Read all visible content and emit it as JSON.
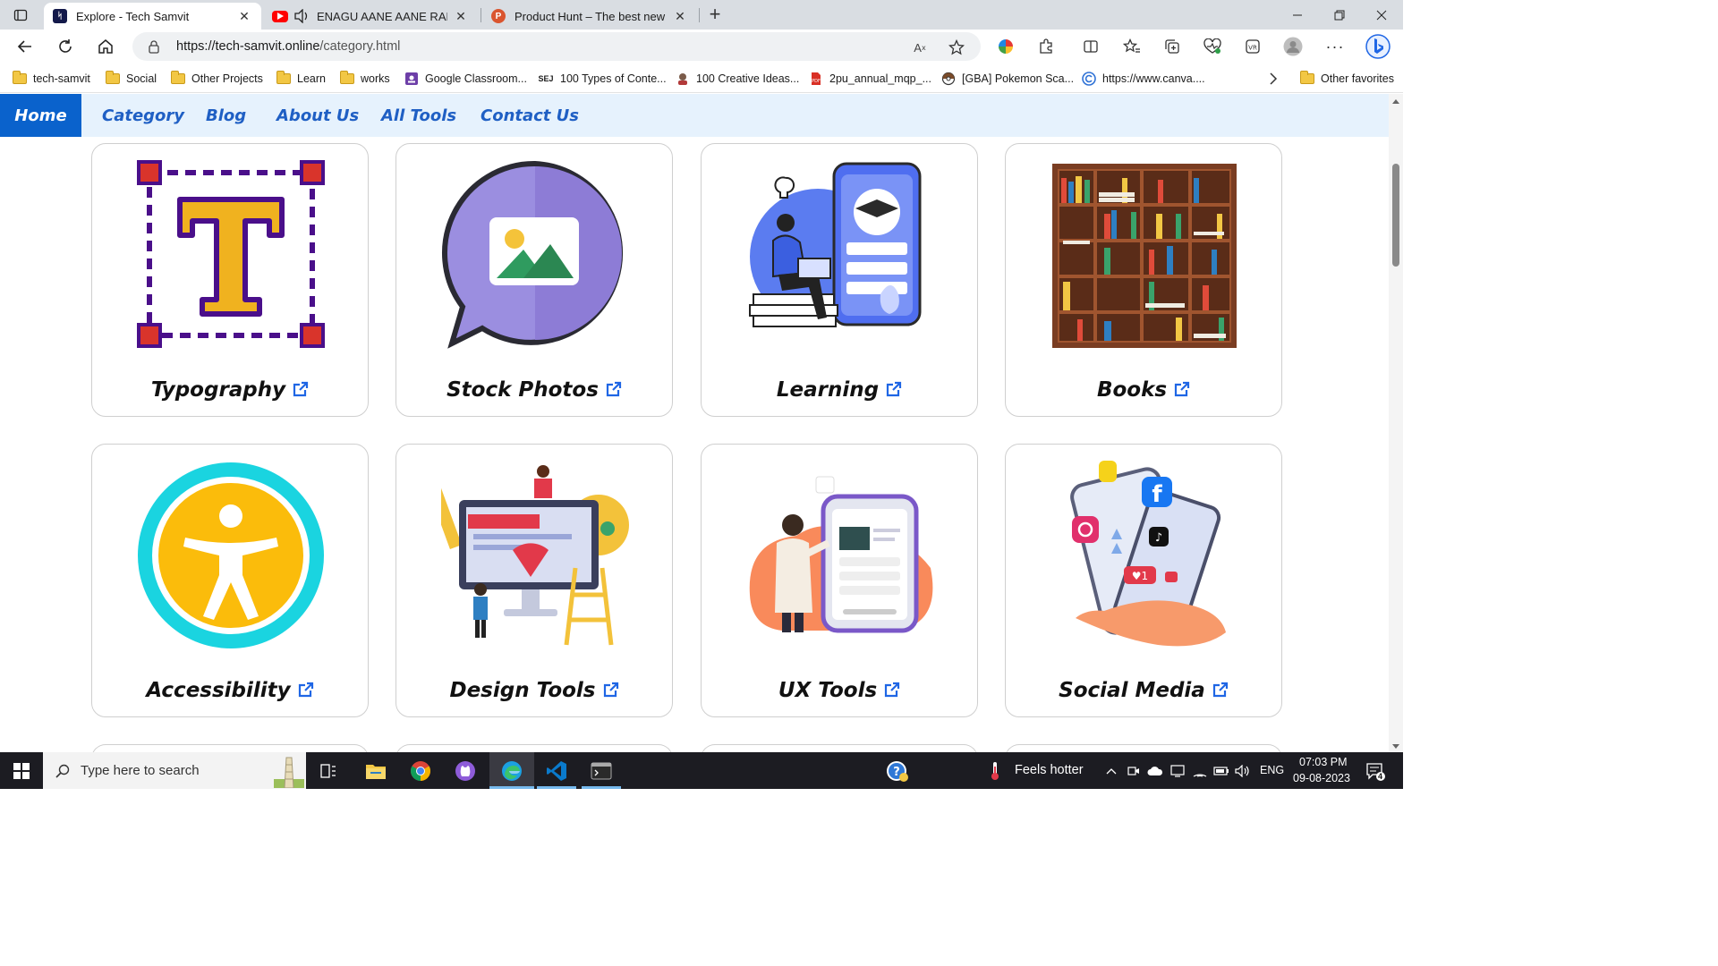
{
  "browser": {
    "tabs": [
      {
        "title": "Explore - Tech Samvit",
        "active": true
      },
      {
        "title": "ENAGU AANE AANE RANGA",
        "active": false
      },
      {
        "title": "Product Hunt – The best new pro",
        "active": false
      }
    ],
    "url_host": "https://tech-samvit.online",
    "url_path": "/category.html",
    "favorites": [
      {
        "label": "tech-samvit",
        "type": "folder"
      },
      {
        "label": "Social",
        "type": "folder"
      },
      {
        "label": "Other Projects",
        "type": "folder"
      },
      {
        "label": "Learn",
        "type": "folder"
      },
      {
        "label": "works",
        "type": "folder"
      },
      {
        "label": "Google Classroom...",
        "type": "site"
      },
      {
        "label": "100 Types of Conte...",
        "type": "site"
      },
      {
        "label": "100 Creative Ideas...",
        "type": "site"
      },
      {
        "label": "2pu_annual_mqp_...",
        "type": "site"
      },
      {
        "label": "[GBA] Pokemon Sca...",
        "type": "site"
      },
      {
        "label": "https://www.canva....",
        "type": "site"
      }
    ],
    "other_favorites": "Other favorites"
  },
  "site": {
    "nav": [
      "Home",
      "Category",
      "Blog",
      "About Us",
      "All Tools",
      "Contact Us"
    ],
    "active_nav": "Home",
    "categories": [
      "Typography",
      "Stock Photos",
      "Learning",
      "Books",
      "Accessibility",
      "Design Tools",
      "UX Tools",
      "Social Media"
    ]
  },
  "taskbar": {
    "search_placeholder": "Type here to search",
    "weather": "Feels hotter",
    "language": "ENG",
    "time": "07:03 PM",
    "date": "09-08-2023",
    "notifications": "4"
  },
  "colors": {
    "accent": "#0a62cc",
    "nav_bg": "#e6f2fd",
    "nav_link": "#1f5fc4"
  }
}
